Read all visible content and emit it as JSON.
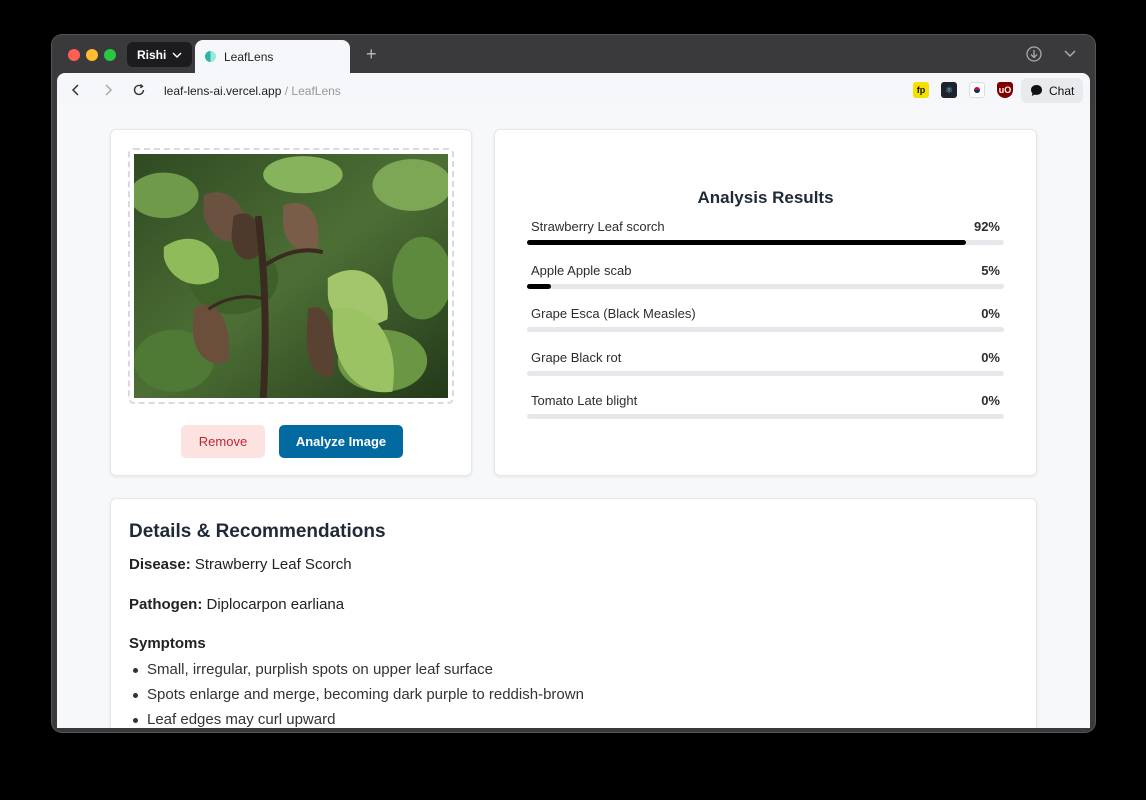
{
  "browser": {
    "profile_name": "Rishi",
    "tab_title": "LeafLens",
    "url_domain": "leaf-lens-ai.vercel.app",
    "url_separator": " / ",
    "url_page": "LeafLens",
    "chat_label": "Chat",
    "extensions": [
      {
        "name": "fp-extension-icon",
        "label": "fp"
      },
      {
        "name": "react-devtools-icon",
        "label": "⚛"
      },
      {
        "name": "korean-flag-extension-icon",
        "label": ""
      },
      {
        "name": "ublock-origin-icon",
        "label": "uO"
      }
    ]
  },
  "upload": {
    "remove_label": "Remove",
    "analyze_label": "Analyze Image"
  },
  "results": {
    "title": "Analysis Results",
    "items": [
      {
        "label": "Strawberry Leaf scorch",
        "percent": "92%",
        "value": 92
      },
      {
        "label": "Apple Apple scab",
        "percent": "5%",
        "value": 5
      },
      {
        "label": "Grape Esca (Black Measles)",
        "percent": "0%",
        "value": 0
      },
      {
        "label": "Grape Black rot",
        "percent": "0%",
        "value": 0
      },
      {
        "label": "Tomato Late blight",
        "percent": "0%",
        "value": 0
      }
    ]
  },
  "details": {
    "title": "Details & Recommendations",
    "disease_label": "Disease:",
    "disease_value": " Strawberry Leaf Scorch",
    "pathogen_label": "Pathogen:",
    "pathogen_value": " Diplocarpon earliana",
    "symptoms_title": "Symptoms",
    "symptoms": [
      "Small, irregular, purplish spots on upper leaf surface",
      "Spots enlarge and merge, becoming dark purple to reddish-brown",
      "Leaf edges may curl upward"
    ]
  }
}
